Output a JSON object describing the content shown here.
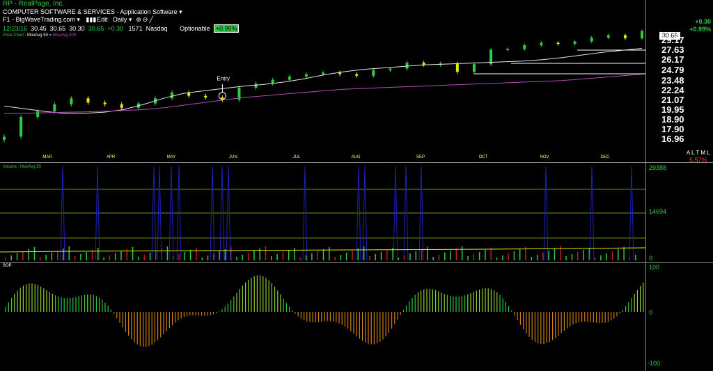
{
  "header": {
    "company": "RP - RealPage, Inc.",
    "sector": "COMPUTER SOFTWARE & SERVICES - Application Software",
    "toolbar": {
      "watermark": "F1 - BigWaveTrading.com",
      "edit": "Edit",
      "period": "Daily"
    },
    "quote": {
      "date": "12/23/16",
      "open": "30.45",
      "high": "30.65",
      "low": "30.30",
      "close": "30.65",
      "change": "+0.30",
      "volume": "1571",
      "exchange": "Nasdaq",
      "optionable": "Optionable",
      "pct": "+0.99%"
    },
    "legend": {
      "chart": "Price Chart :",
      "ma50": "MovAvg 50 =",
      "ma200": "MovAvg 200"
    },
    "change": "+0.30",
    "change_pct": "+0.99%",
    "last_price": "30.65",
    "alert": "A L T M L",
    "alert_pct": "5.57%"
  },
  "chart_data": [
    {
      "type": "line",
      "title": "Price Chart",
      "y_ticks": [
        "29.17",
        "27.63",
        "26.17",
        "24.79",
        "23.48",
        "22.24",
        "21.07",
        "19.95",
        "18.90",
        "17.90",
        "16.96"
      ],
      "x_ticks": [
        "MAR",
        "APR",
        "MAY",
        "JUN",
        "JUL",
        "AUG",
        "SEP",
        "OCT",
        "NOV",
        "DEC"
      ],
      "annotation": "Entry",
      "series": [
        {
          "name": "MovAvg 50",
          "values": [
            20.4,
            20.1,
            19.8,
            19.6,
            19.6,
            19.7,
            20.0,
            20.6,
            21.3,
            21.9,
            22.2,
            22.5,
            22.8,
            23.0,
            23.3,
            23.7,
            24.2,
            24.6,
            24.9,
            25.1,
            25.3,
            25.5,
            25.6,
            25.7,
            25.8,
            25.9,
            26.0,
            26.2,
            26.5,
            26.9,
            27.3,
            27.6,
            27.9
          ]
        },
        {
          "name": "MovAvg 200",
          "values": [
            19.55,
            19.6,
            19.65,
            19.7,
            19.75,
            19.8,
            19.9,
            20.0,
            20.2,
            20.5,
            20.8,
            21.1,
            21.4,
            21.6,
            21.8,
            22.0,
            22.2,
            22.4,
            22.5,
            22.6,
            22.7,
            22.8,
            22.9,
            23.0,
            23.1,
            23.2,
            23.3,
            23.4,
            23.5,
            23.7,
            23.9,
            24.1,
            24.3
          ]
        }
      ],
      "close": [
        17.2,
        19.2,
        19.8,
        20.6,
        21.3,
        20.8,
        20.6,
        20.2,
        20.7,
        21.3,
        22.0,
        21.6,
        21.4,
        21.1,
        22.6,
        23.1,
        23.6,
        24.0,
        24.3,
        24.5,
        24.3,
        24.1,
        24.8,
        25.0,
        25.8,
        25.5,
        25.7,
        24.6,
        25.6,
        27.7,
        27.8,
        28.4,
        28.8,
        28.6,
        29.0,
        29.6,
        30.0,
        29.5,
        30.65
      ]
    },
    {
      "type": "bar",
      "title": "Volume : MovAvg 50",
      "y_ticks": [
        "29388",
        "14694",
        "0"
      ]
    },
    {
      "type": "bar",
      "title": "BOP",
      "y_ticks": [
        "100",
        "0",
        "-100"
      ]
    }
  ],
  "colors": {
    "up": "#2ecc40",
    "down": "#e8e800",
    "ma50": "#e6e6e6",
    "ma200": "#b24db2",
    "volume_spike": "#2020c0"
  }
}
